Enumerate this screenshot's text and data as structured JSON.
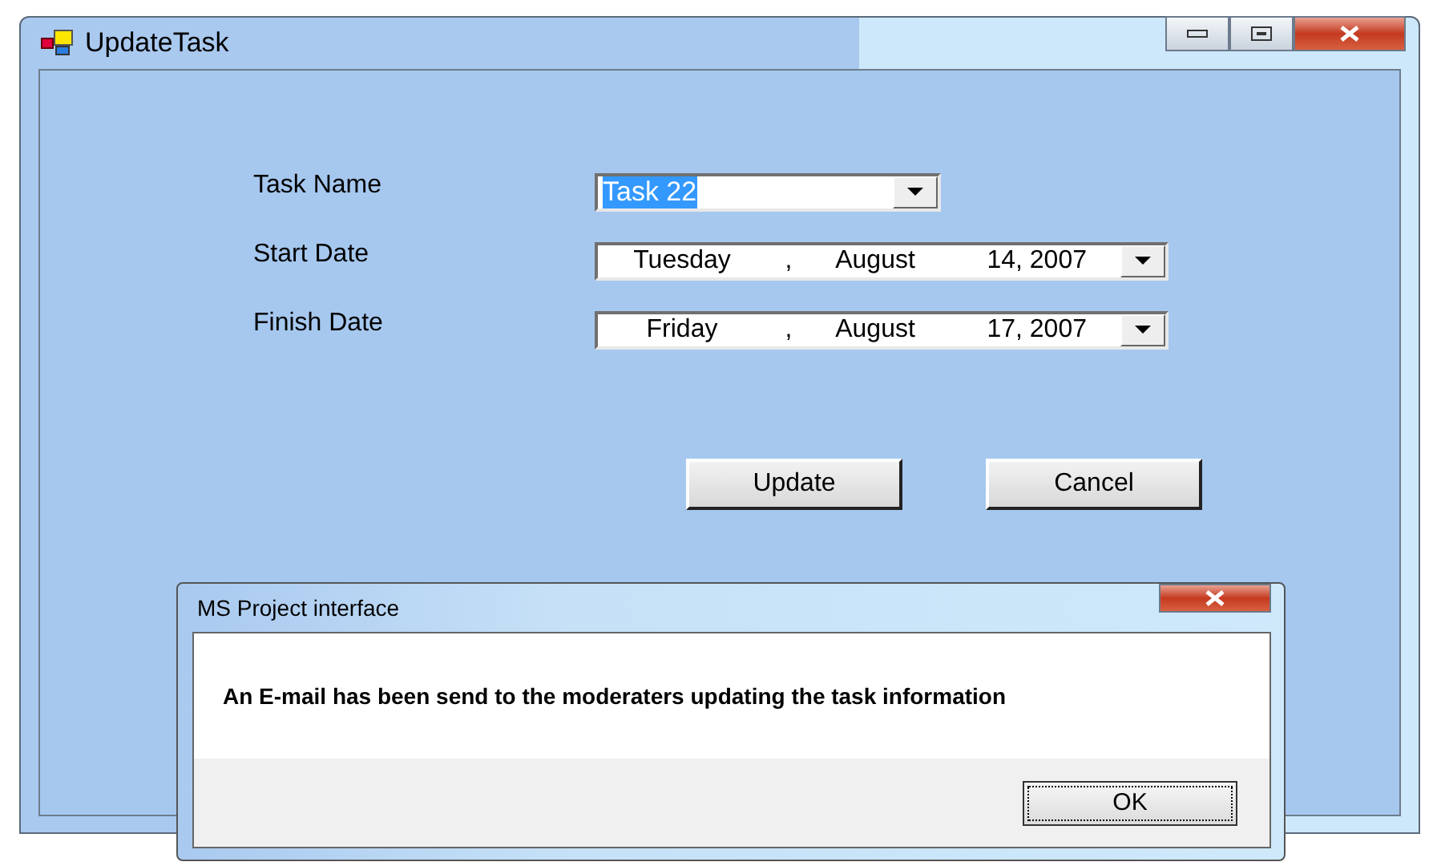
{
  "window": {
    "title": "UpdateTask"
  },
  "fields": [
    {
      "kind": "combo",
      "label": "Task Name",
      "value": "Task 22",
      "text_selected": true
    },
    {
      "kind": "date",
      "label": "Start Date",
      "parts": [
        "Tuesday",
        ",",
        "August",
        "14, 2007"
      ]
    },
    {
      "kind": "date",
      "label": "Finish Date",
      "parts": [
        "Friday",
        ",",
        "August",
        "17, 2007"
      ]
    }
  ],
  "buttons": [
    "Update",
    "Cancel"
  ],
  "dialog": {
    "title": "MS Project interface",
    "message": "An E-mail has been send to the moderaters updating the task information",
    "button": "OK"
  }
}
